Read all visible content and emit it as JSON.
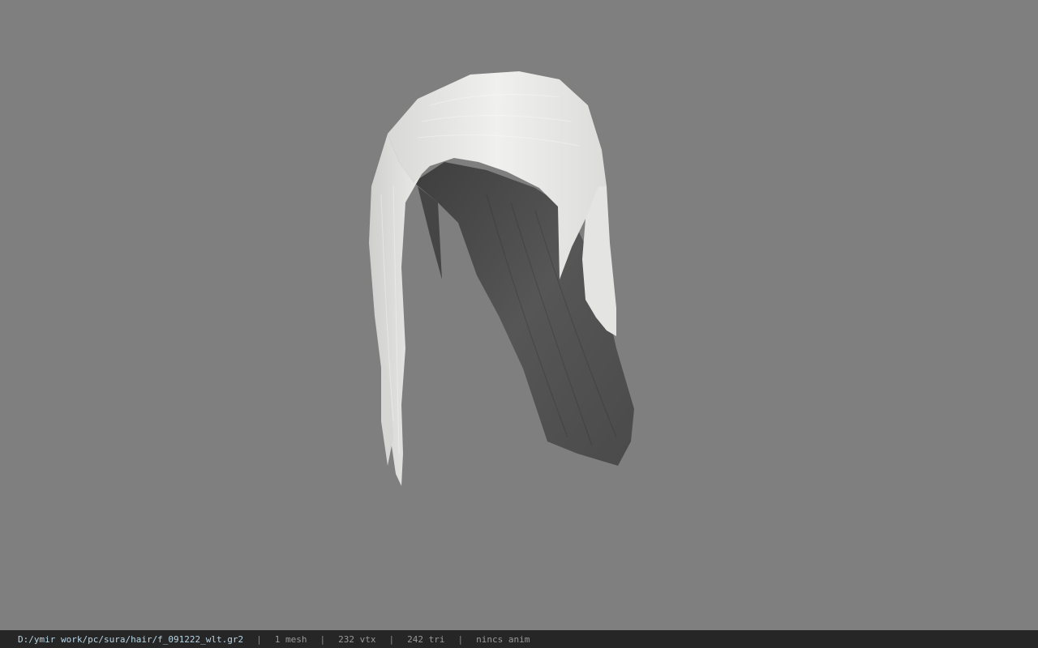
{
  "viewport": {
    "background": "#7f7f7f",
    "model": "hair-mesh"
  },
  "statusbar": {
    "file_path": "D:/ymir work/pc/sura/hair/f_091222_wlt.gr2",
    "separator": "|",
    "mesh_count": "1 mesh",
    "vertex_count": "232 vtx",
    "triangle_count": "242 tri",
    "anim_status": "nincs anim"
  },
  "colors": {
    "hair_light": "#e6e6e6",
    "hair_inner": "#4f4f4f",
    "statusbar_bg": "#262626",
    "path_text": "#b8d6e6"
  }
}
